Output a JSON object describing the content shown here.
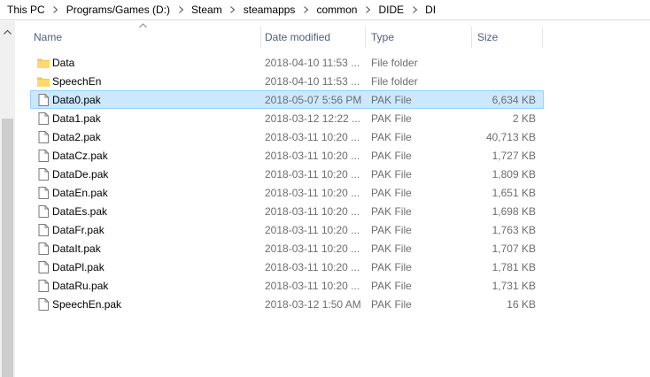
{
  "breadcrumb": [
    "This PC",
    "Programs/Games (D:)",
    "Steam",
    "steamapps",
    "common",
    "DIDE",
    "DI"
  ],
  "columns": {
    "name": "Name",
    "date": "Date modified",
    "type": "Type",
    "size": "Size"
  },
  "colors": {
    "selected_bg": "#cce8ff",
    "selected_border": "#99d1ff",
    "header_text": "#4c607a",
    "folder": "#f2c55c"
  },
  "files": [
    {
      "name": "Data",
      "date": "2018-04-10 11:53 ...",
      "type": "File folder",
      "size": "",
      "icon": "folder-icon",
      "selected": false
    },
    {
      "name": "SpeechEn",
      "date": "2018-04-10 11:53 ...",
      "type": "File folder",
      "size": "",
      "icon": "folder-icon",
      "selected": false
    },
    {
      "name": "Data0.pak",
      "date": "2018-05-07 5:56 PM",
      "type": "PAK File",
      "size": "6,634 KB",
      "icon": "file-icon",
      "selected": true
    },
    {
      "name": "Data1.pak",
      "date": "2018-03-12 12:22 ...",
      "type": "PAK File",
      "size": "2 KB",
      "icon": "file-icon",
      "selected": false
    },
    {
      "name": "Data2.pak",
      "date": "2018-03-11 10:20 ...",
      "type": "PAK File",
      "size": "40,713 KB",
      "icon": "file-icon",
      "selected": false
    },
    {
      "name": "DataCz.pak",
      "date": "2018-03-11 10:20 ...",
      "type": "PAK File",
      "size": "1,727 KB",
      "icon": "file-icon",
      "selected": false
    },
    {
      "name": "DataDe.pak",
      "date": "2018-03-11 10:20 ...",
      "type": "PAK File",
      "size": "1,809 KB",
      "icon": "file-icon",
      "selected": false
    },
    {
      "name": "DataEn.pak",
      "date": "2018-03-11 10:20 ...",
      "type": "PAK File",
      "size": "1,651 KB",
      "icon": "file-icon",
      "selected": false
    },
    {
      "name": "DataEs.pak",
      "date": "2018-03-11 10:20 ...",
      "type": "PAK File",
      "size": "1,698 KB",
      "icon": "file-icon",
      "selected": false
    },
    {
      "name": "DataFr.pak",
      "date": "2018-03-11 10:20 ...",
      "type": "PAK File",
      "size": "1,763 KB",
      "icon": "file-icon",
      "selected": false
    },
    {
      "name": "DataIt.pak",
      "date": "2018-03-11 10:20 ...",
      "type": "PAK File",
      "size": "1,707 KB",
      "icon": "file-icon",
      "selected": false
    },
    {
      "name": "DataPl.pak",
      "date": "2018-03-11 10:20 ...",
      "type": "PAK File",
      "size": "1,781 KB",
      "icon": "file-icon",
      "selected": false
    },
    {
      "name": "DataRu.pak",
      "date": "2018-03-11 10:20 ...",
      "type": "PAK File",
      "size": "1,731 KB",
      "icon": "file-icon",
      "selected": false
    },
    {
      "name": "SpeechEn.pak",
      "date": "2018-03-12 1:50 AM",
      "type": "PAK File",
      "size": "16 KB",
      "icon": "file-icon",
      "selected": false
    }
  ]
}
